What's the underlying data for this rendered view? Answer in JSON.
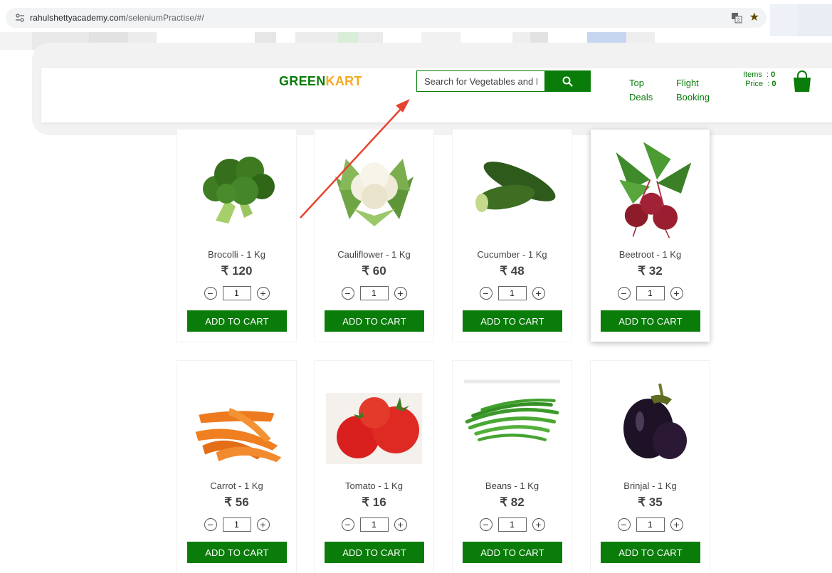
{
  "browser": {
    "url_host": "rahulshettyacademy.com",
    "url_path": "/seleniumPractise/#/"
  },
  "header": {
    "brand_part1": "GREEN",
    "brand_part2": "KART",
    "search_placeholder": "Search for Vegetables and Fruits",
    "nav": [
      {
        "line1": "Top",
        "line2": "Deals"
      },
      {
        "line1": "Flight",
        "line2": "Booking"
      }
    ],
    "cart": {
      "items_label": "Items",
      "items_value": "0",
      "price_label": "Price",
      "price_value": "0"
    }
  },
  "products": [
    {
      "name": "Brocolli - 1 Kg",
      "price": "₹ 120",
      "qty": "1",
      "button": "ADD TO CART",
      "image": "broccoli-image"
    },
    {
      "name": "Cauliflower - 1 Kg",
      "price": "₹ 60",
      "qty": "1",
      "button": "ADD TO CART",
      "image": "cauliflower-image"
    },
    {
      "name": "Cucumber - 1 Kg",
      "price": "₹ 48",
      "qty": "1",
      "button": "ADD TO CART",
      "image": "cucumber-image"
    },
    {
      "name": "Beetroot - 1 Kg",
      "price": "₹ 32",
      "qty": "1",
      "button": "ADD TO CART",
      "image": "beetroot-image"
    },
    {
      "name": "Carrot - 1 Kg",
      "price": "₹ 56",
      "qty": "1",
      "button": "ADD TO CART",
      "image": "carrot-image"
    },
    {
      "name": "Tomato - 1 Kg",
      "price": "₹ 16",
      "qty": "1",
      "button": "ADD TO CART",
      "image": "tomato-image"
    },
    {
      "name": "Beans - 1 Kg",
      "price": "₹ 82",
      "qty": "1",
      "button": "ADD TO CART",
      "image": "beans-image"
    },
    {
      "name": "Brinjal - 1 Kg",
      "price": "₹ 35",
      "qty": "1",
      "button": "ADD TO CART",
      "image": "brinjal-image"
    }
  ],
  "colors": {
    "brand_green": "#0a7c0a",
    "brand_orange": "#f7a823",
    "annotation_arrow": "#e8432f"
  }
}
